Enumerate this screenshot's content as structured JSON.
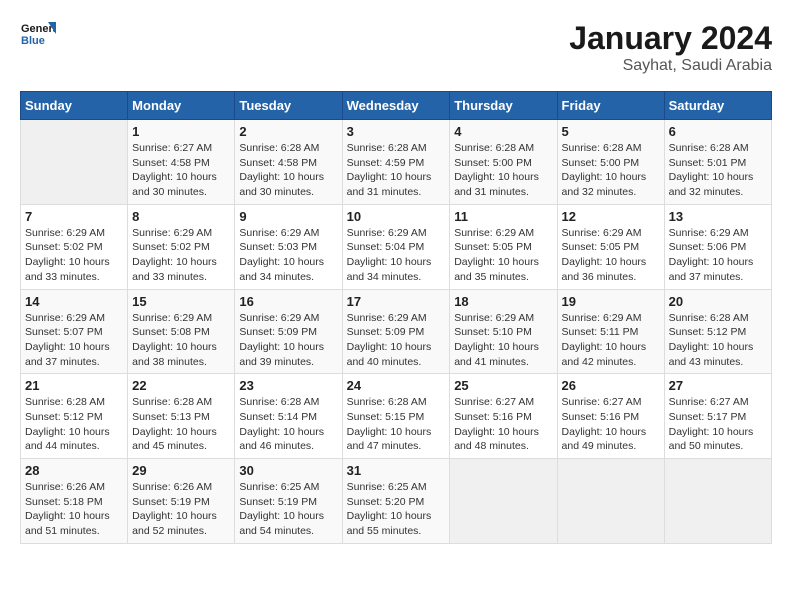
{
  "header": {
    "logo_line1": "General",
    "logo_line2": "Blue",
    "month_title": "January 2024",
    "location": "Sayhat, Saudi Arabia"
  },
  "weekdays": [
    "Sunday",
    "Monday",
    "Tuesday",
    "Wednesday",
    "Thursday",
    "Friday",
    "Saturday"
  ],
  "weeks": [
    [
      {
        "day": "",
        "info": ""
      },
      {
        "day": "1",
        "info": "Sunrise: 6:27 AM\nSunset: 4:58 PM\nDaylight: 10 hours\nand 30 minutes."
      },
      {
        "day": "2",
        "info": "Sunrise: 6:28 AM\nSunset: 4:58 PM\nDaylight: 10 hours\nand 30 minutes."
      },
      {
        "day": "3",
        "info": "Sunrise: 6:28 AM\nSunset: 4:59 PM\nDaylight: 10 hours\nand 31 minutes."
      },
      {
        "day": "4",
        "info": "Sunrise: 6:28 AM\nSunset: 5:00 PM\nDaylight: 10 hours\nand 31 minutes."
      },
      {
        "day": "5",
        "info": "Sunrise: 6:28 AM\nSunset: 5:00 PM\nDaylight: 10 hours\nand 32 minutes."
      },
      {
        "day": "6",
        "info": "Sunrise: 6:28 AM\nSunset: 5:01 PM\nDaylight: 10 hours\nand 32 minutes."
      }
    ],
    [
      {
        "day": "7",
        "info": "Sunrise: 6:29 AM\nSunset: 5:02 PM\nDaylight: 10 hours\nand 33 minutes."
      },
      {
        "day": "8",
        "info": "Sunrise: 6:29 AM\nSunset: 5:02 PM\nDaylight: 10 hours\nand 33 minutes."
      },
      {
        "day": "9",
        "info": "Sunrise: 6:29 AM\nSunset: 5:03 PM\nDaylight: 10 hours\nand 34 minutes."
      },
      {
        "day": "10",
        "info": "Sunrise: 6:29 AM\nSunset: 5:04 PM\nDaylight: 10 hours\nand 34 minutes."
      },
      {
        "day": "11",
        "info": "Sunrise: 6:29 AM\nSunset: 5:05 PM\nDaylight: 10 hours\nand 35 minutes."
      },
      {
        "day": "12",
        "info": "Sunrise: 6:29 AM\nSunset: 5:05 PM\nDaylight: 10 hours\nand 36 minutes."
      },
      {
        "day": "13",
        "info": "Sunrise: 6:29 AM\nSunset: 5:06 PM\nDaylight: 10 hours\nand 37 minutes."
      }
    ],
    [
      {
        "day": "14",
        "info": "Sunrise: 6:29 AM\nSunset: 5:07 PM\nDaylight: 10 hours\nand 37 minutes."
      },
      {
        "day": "15",
        "info": "Sunrise: 6:29 AM\nSunset: 5:08 PM\nDaylight: 10 hours\nand 38 minutes."
      },
      {
        "day": "16",
        "info": "Sunrise: 6:29 AM\nSunset: 5:09 PM\nDaylight: 10 hours\nand 39 minutes."
      },
      {
        "day": "17",
        "info": "Sunrise: 6:29 AM\nSunset: 5:09 PM\nDaylight: 10 hours\nand 40 minutes."
      },
      {
        "day": "18",
        "info": "Sunrise: 6:29 AM\nSunset: 5:10 PM\nDaylight: 10 hours\nand 41 minutes."
      },
      {
        "day": "19",
        "info": "Sunrise: 6:29 AM\nSunset: 5:11 PM\nDaylight: 10 hours\nand 42 minutes."
      },
      {
        "day": "20",
        "info": "Sunrise: 6:28 AM\nSunset: 5:12 PM\nDaylight: 10 hours\nand 43 minutes."
      }
    ],
    [
      {
        "day": "21",
        "info": "Sunrise: 6:28 AM\nSunset: 5:12 PM\nDaylight: 10 hours\nand 44 minutes."
      },
      {
        "day": "22",
        "info": "Sunrise: 6:28 AM\nSunset: 5:13 PM\nDaylight: 10 hours\nand 45 minutes."
      },
      {
        "day": "23",
        "info": "Sunrise: 6:28 AM\nSunset: 5:14 PM\nDaylight: 10 hours\nand 46 minutes."
      },
      {
        "day": "24",
        "info": "Sunrise: 6:28 AM\nSunset: 5:15 PM\nDaylight: 10 hours\nand 47 minutes."
      },
      {
        "day": "25",
        "info": "Sunrise: 6:27 AM\nSunset: 5:16 PM\nDaylight: 10 hours\nand 48 minutes."
      },
      {
        "day": "26",
        "info": "Sunrise: 6:27 AM\nSunset: 5:16 PM\nDaylight: 10 hours\nand 49 minutes."
      },
      {
        "day": "27",
        "info": "Sunrise: 6:27 AM\nSunset: 5:17 PM\nDaylight: 10 hours\nand 50 minutes."
      }
    ],
    [
      {
        "day": "28",
        "info": "Sunrise: 6:26 AM\nSunset: 5:18 PM\nDaylight: 10 hours\nand 51 minutes."
      },
      {
        "day": "29",
        "info": "Sunrise: 6:26 AM\nSunset: 5:19 PM\nDaylight: 10 hours\nand 52 minutes."
      },
      {
        "day": "30",
        "info": "Sunrise: 6:25 AM\nSunset: 5:19 PM\nDaylight: 10 hours\nand 54 minutes."
      },
      {
        "day": "31",
        "info": "Sunrise: 6:25 AM\nSunset: 5:20 PM\nDaylight: 10 hours\nand 55 minutes."
      },
      {
        "day": "",
        "info": ""
      },
      {
        "day": "",
        "info": ""
      },
      {
        "day": "",
        "info": ""
      }
    ]
  ]
}
